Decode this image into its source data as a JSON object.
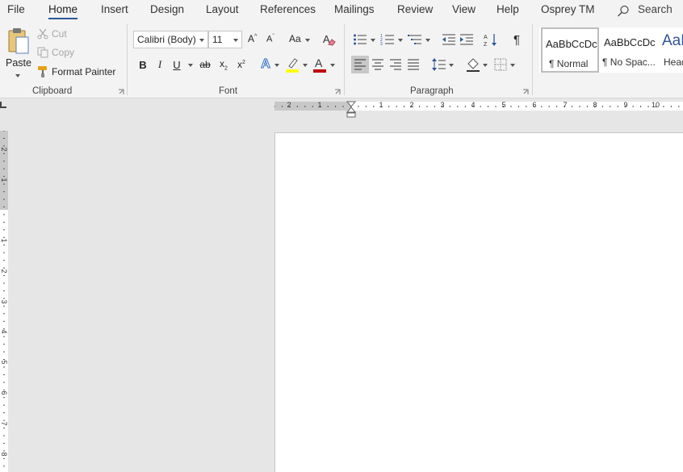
{
  "tabs": [
    "File",
    "Home",
    "Insert",
    "Design",
    "Layout",
    "References",
    "Mailings",
    "Review",
    "View",
    "Help",
    "Osprey TM"
  ],
  "active_tab": "Home",
  "search": {
    "label": "Search",
    "icon": "search-icon"
  },
  "clipboard": {
    "paste_label": "Paste",
    "cut_label": "Cut",
    "copy_label": "Copy",
    "format_painter_label": "Format Painter",
    "group_label": "Clipboard"
  },
  "font": {
    "name": "Calibri (Body)",
    "size": "11",
    "group_label": "Font",
    "font_color": "#c00000",
    "highlight_color": "#ffff00"
  },
  "paragraph": {
    "group_label": "Paragraph"
  },
  "styles": [
    {
      "sample": "AaBbCcDc",
      "name": "¶ Normal"
    },
    {
      "sample": "AaBbCcDc",
      "name": "¶ No Spac..."
    },
    {
      "sample": "AaB",
      "name": "Head"
    }
  ],
  "ruler": {
    "horizontal_numbers": [
      "2",
      "1",
      "1",
      "2",
      "3",
      "4",
      "5",
      "6",
      "7",
      "8",
      "9",
      "10"
    ],
    "vertical_numbers": [
      "2",
      "1",
      "1",
      "2",
      "3",
      "4",
      "5",
      "6",
      "7",
      "8"
    ]
  },
  "colors": {
    "accent": "#2b579a",
    "ribbon_bg": "#f3f3f3",
    "canvas_bg": "#e6e6e6"
  }
}
